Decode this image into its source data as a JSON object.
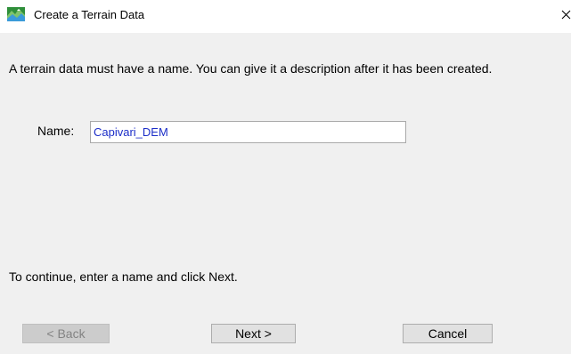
{
  "window": {
    "title": "Create a Terrain Data",
    "icon": "terrain-map-icon",
    "close_icon": "close-icon"
  },
  "dialog": {
    "description": "A terrain data must have a name. You can give it a description after it has been created.",
    "name_label": "Name:",
    "name_value": "Capivari_DEM",
    "hint": "To continue, enter a name and click Next."
  },
  "buttons": {
    "back": {
      "label": "< Back",
      "enabled": false
    },
    "next": {
      "label": "Next >",
      "enabled": true
    },
    "cancel": {
      "label": "Cancel",
      "enabled": true
    }
  },
  "colors": {
    "dialog_background": "#f0f0f0",
    "input_text": "#1c2ec8",
    "disabled_text": "#838383"
  }
}
